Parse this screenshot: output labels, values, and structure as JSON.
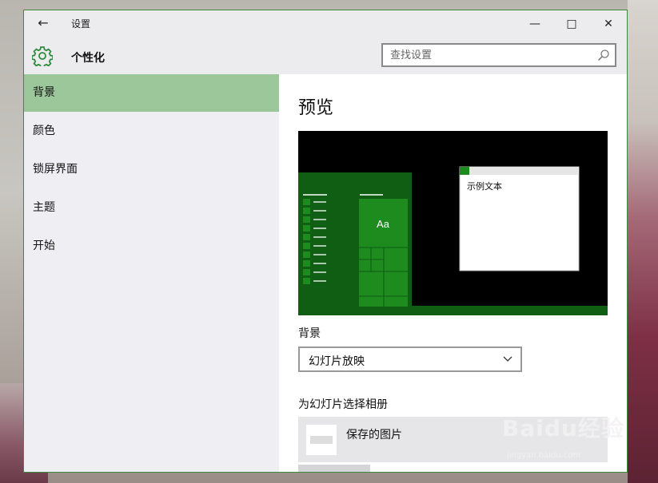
{
  "window": {
    "title": "设置"
  },
  "header": {
    "title": "个性化",
    "search_placeholder": "查找设置"
  },
  "sidebar": {
    "items": [
      {
        "label": "背景",
        "active": true
      },
      {
        "label": "颜色",
        "active": false
      },
      {
        "label": "锁屏界面",
        "active": false
      },
      {
        "label": "主题",
        "active": false
      },
      {
        "label": "开始",
        "active": false
      }
    ]
  },
  "main": {
    "preview_title": "预览",
    "preview_sample_text": "示例文本",
    "preview_tile_text": "Aa",
    "background_label": "背景",
    "background_value": "幻灯片放映",
    "album_label": "为幻灯片选择相册",
    "album_item": "保存的图片"
  },
  "watermark": {
    "brand": "Baidu经验",
    "url": "jingyan.baidu.com"
  },
  "colors": {
    "accent": "#9cc79a",
    "start_green": "#0f5e13",
    "tile_green": "#1e8b1e",
    "window_border": "#3c8a3c"
  },
  "icons": [
    "back-arrow-icon",
    "minimize-icon",
    "maximize-icon",
    "close-icon",
    "gear-icon",
    "search-icon",
    "chevron-down-icon"
  ]
}
